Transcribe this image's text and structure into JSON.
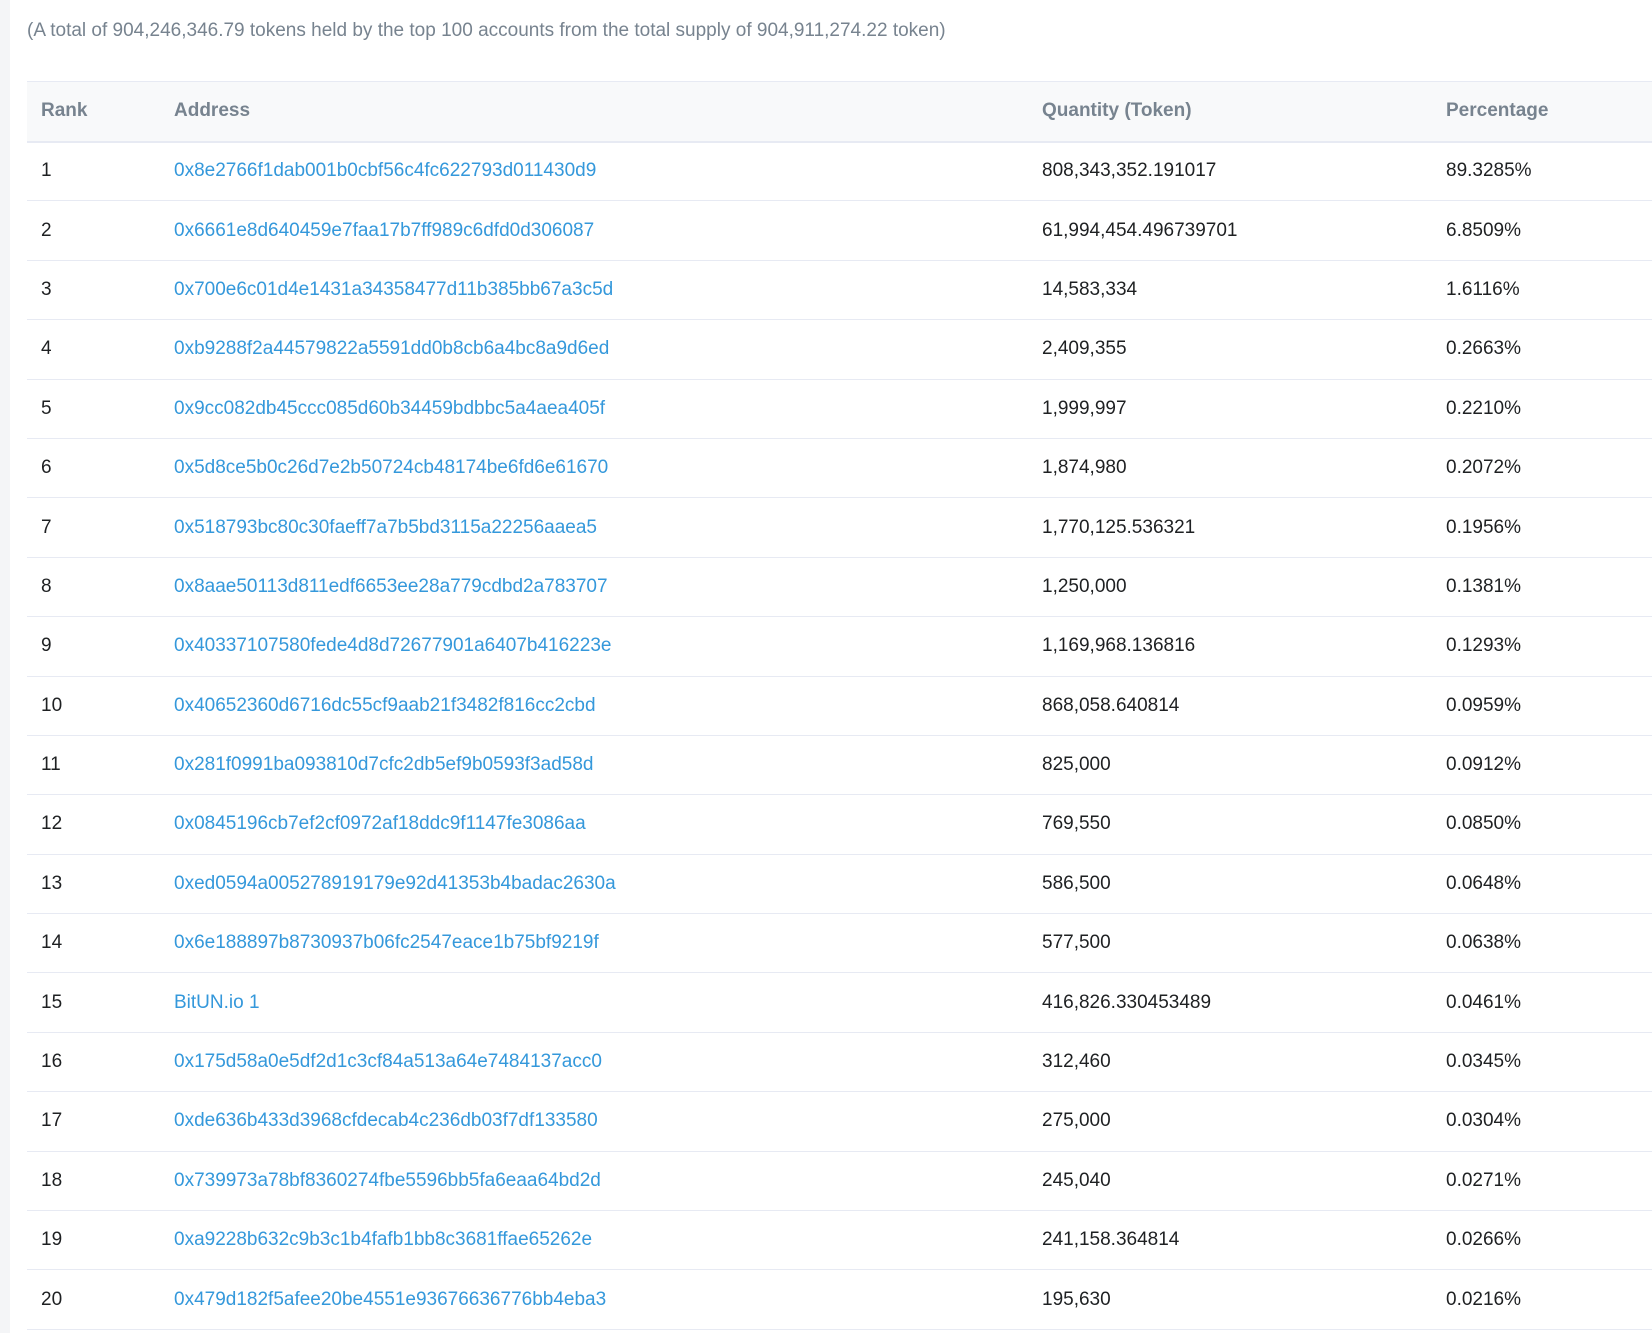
{
  "summary": "(A total of 904,246,346.79 tokens held by the top 100 accounts from the total supply of 904,911,274.22 token)",
  "table": {
    "headers": {
      "rank": "Rank",
      "address": "Address",
      "quantity": "Quantity (Token)",
      "percentage": "Percentage"
    },
    "rows": [
      {
        "rank": "1",
        "address": "0x8e2766f1dab001b0cbf56c4fc622793d011430d9",
        "quantity": "808,343,352.191017",
        "percentage": "89.3285%"
      },
      {
        "rank": "2",
        "address": "0x6661e8d640459e7faa17b7ff989c6dfd0d306087",
        "quantity": "61,994,454.496739701",
        "percentage": "6.8509%"
      },
      {
        "rank": "3",
        "address": "0x700e6c01d4e1431a34358477d11b385bb67a3c5d",
        "quantity": "14,583,334",
        "percentage": "1.6116%"
      },
      {
        "rank": "4",
        "address": "0xb9288f2a44579822a5591dd0b8cb6a4bc8a9d6ed",
        "quantity": "2,409,355",
        "percentage": "0.2663%"
      },
      {
        "rank": "5",
        "address": "0x9cc082db45ccc085d60b34459bdbbc5a4aea405f",
        "quantity": "1,999,997",
        "percentage": "0.2210%"
      },
      {
        "rank": "6",
        "address": "0x5d8ce5b0c26d7e2b50724cb48174be6fd6e61670",
        "quantity": "1,874,980",
        "percentage": "0.2072%"
      },
      {
        "rank": "7",
        "address": "0x518793bc80c30faeff7a7b5bd3115a22256aaea5",
        "quantity": "1,770,125.536321",
        "percentage": "0.1956%"
      },
      {
        "rank": "8",
        "address": "0x8aae50113d811edf6653ee28a779cdbd2a783707",
        "quantity": "1,250,000",
        "percentage": "0.1381%"
      },
      {
        "rank": "9",
        "address": "0x40337107580fede4d8d72677901a6407b416223e",
        "quantity": "1,169,968.136816",
        "percentage": "0.1293%"
      },
      {
        "rank": "10",
        "address": "0x40652360d6716dc55cf9aab21f3482f816cc2cbd",
        "quantity": "868,058.640814",
        "percentage": "0.0959%"
      },
      {
        "rank": "11",
        "address": "0x281f0991ba093810d7cfc2db5ef9b0593f3ad58d",
        "quantity": "825,000",
        "percentage": "0.0912%"
      },
      {
        "rank": "12",
        "address": "0x0845196cb7ef2cf0972af18ddc9f1147fe3086aa",
        "quantity": "769,550",
        "percentage": "0.0850%"
      },
      {
        "rank": "13",
        "address": "0xed0594a005278919179e92d41353b4badac2630a",
        "quantity": "586,500",
        "percentage": "0.0648%"
      },
      {
        "rank": "14",
        "address": "0x6e188897b8730937b06fc2547eace1b75bf9219f",
        "quantity": "577,500",
        "percentage": "0.0638%"
      },
      {
        "rank": "15",
        "address": "BitUN.io 1",
        "quantity": "416,826.330453489",
        "percentage": "0.0461%"
      },
      {
        "rank": "16",
        "address": "0x175d58a0e5df2d1c3cf84a513a64e7484137acc0",
        "quantity": "312,460",
        "percentage": "0.0345%"
      },
      {
        "rank": "17",
        "address": "0xde636b433d3968cfdecab4c236db03f7df133580",
        "quantity": "275,000",
        "percentage": "0.0304%"
      },
      {
        "rank": "18",
        "address": "0x739973a78bf8360274fbe5596bb5fa6eaa64bd2d",
        "quantity": "245,040",
        "percentage": "0.0271%"
      },
      {
        "rank": "19",
        "address": "0xa9228b632c9b3c1b4fafb1bb8c3681ffae65262e",
        "quantity": "241,158.364814",
        "percentage": "0.0266%"
      },
      {
        "rank": "20",
        "address": "0x479d182f5afee20be4551e93676636776bb4eba3",
        "quantity": "195,630",
        "percentage": "0.0216%"
      }
    ]
  }
}
